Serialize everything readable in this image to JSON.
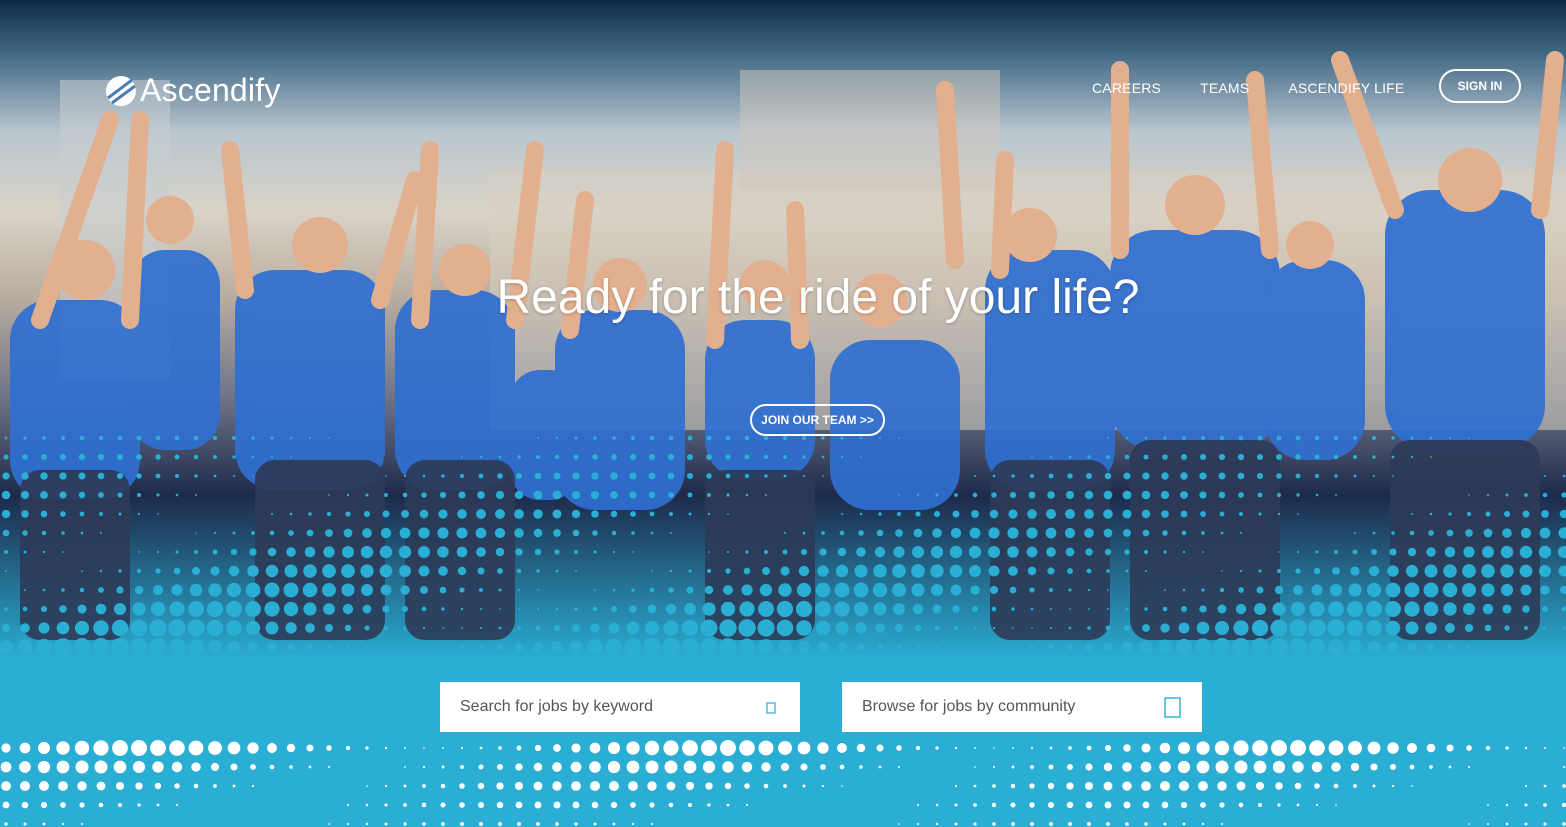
{
  "brand": {
    "name": "Ascendify",
    "accent_color": "#2aaed3"
  },
  "nav": {
    "items": [
      {
        "label": "CAREERS"
      },
      {
        "label": "TEAMS"
      },
      {
        "label": "ASCENDIFY LIFE"
      }
    ],
    "signin_label": "SIGN IN"
  },
  "hero": {
    "headline": "Ready for the ride of your life?",
    "cta_label": "JOIN OUR TEAM >>",
    "image_icon": "team-photo"
  },
  "search": {
    "keyword_placeholder": "Search for jobs by keyword",
    "keyword_icon": "search-icon",
    "community_placeholder": "Browse for jobs by community",
    "community_icon": "dropdown-box-icon"
  }
}
